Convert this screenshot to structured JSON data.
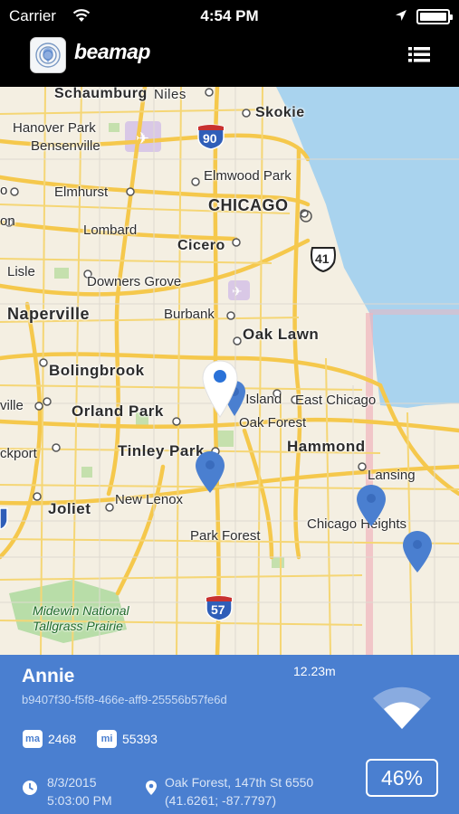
{
  "status_bar": {
    "carrier": "Carrier",
    "time": "4:54 PM"
  },
  "nav": {
    "app_name": "beamap",
    "logo_icon": "beacon-rings-icon",
    "menu_icon": "list-menu-icon"
  },
  "map": {
    "labels": {
      "schaumburg": "Schaumburg",
      "niles": "Niles",
      "skokie": "Skokie",
      "hanover_park": "Hanover Park",
      "bensenville": "Bensenville",
      "elmwood_park": "Elmwood Park",
      "elmhurst": "Elmhurst",
      "chicago": "CHICAGO",
      "lombard": "Lombard",
      "cicero": "Cicero",
      "lisle": "Lisle",
      "downers_grove": "Downers Grove",
      "naperville": "Naperville",
      "burbank": "Burbank",
      "oak_lawn": "Oak Lawn",
      "bolingbrook": "Bolingbrook",
      "blue_island": "Blue Island",
      "east_chicago": "East Chicago",
      "orland_park": "Orland Park",
      "oak_forest": "Oak Forest",
      "tinley_park": "Tinley Park",
      "hammond": "Hammond",
      "lansing": "Lansing",
      "new_lenox": "New Lenox",
      "joliet": "Joliet",
      "chicago_heights": "Chicago Heights",
      "park_forest": "Park Forest",
      "midewin_1": "Midewin National",
      "midewin_2": "Tallgrass Prairie",
      "edge_on": "on",
      "edge_ville": "ville",
      "edge_ckport": "ckport",
      "edge_o": "o"
    },
    "shields": {
      "i90": "90",
      "us41": "41",
      "i57": "57"
    }
  },
  "info": {
    "name": "Annie",
    "distance": "12.23m",
    "uuid": "b9407f30-f5f8-466e-aff9-25556b57fe6d",
    "major_label": "ma",
    "major_value": "2468",
    "minor_label": "mi",
    "minor_value": "55393",
    "date": "8/3/2015",
    "time": "5:03:00 PM",
    "location": "Oak Forest, 147th St 6550",
    "coordinates": "(41.6261; -87.7797)",
    "signal_percent": "46%"
  },
  "colors": {
    "panel": "#4a7fd0",
    "water": "#a9d3ee",
    "road": "#f5c84c",
    "pin": "#4a7fd0"
  }
}
